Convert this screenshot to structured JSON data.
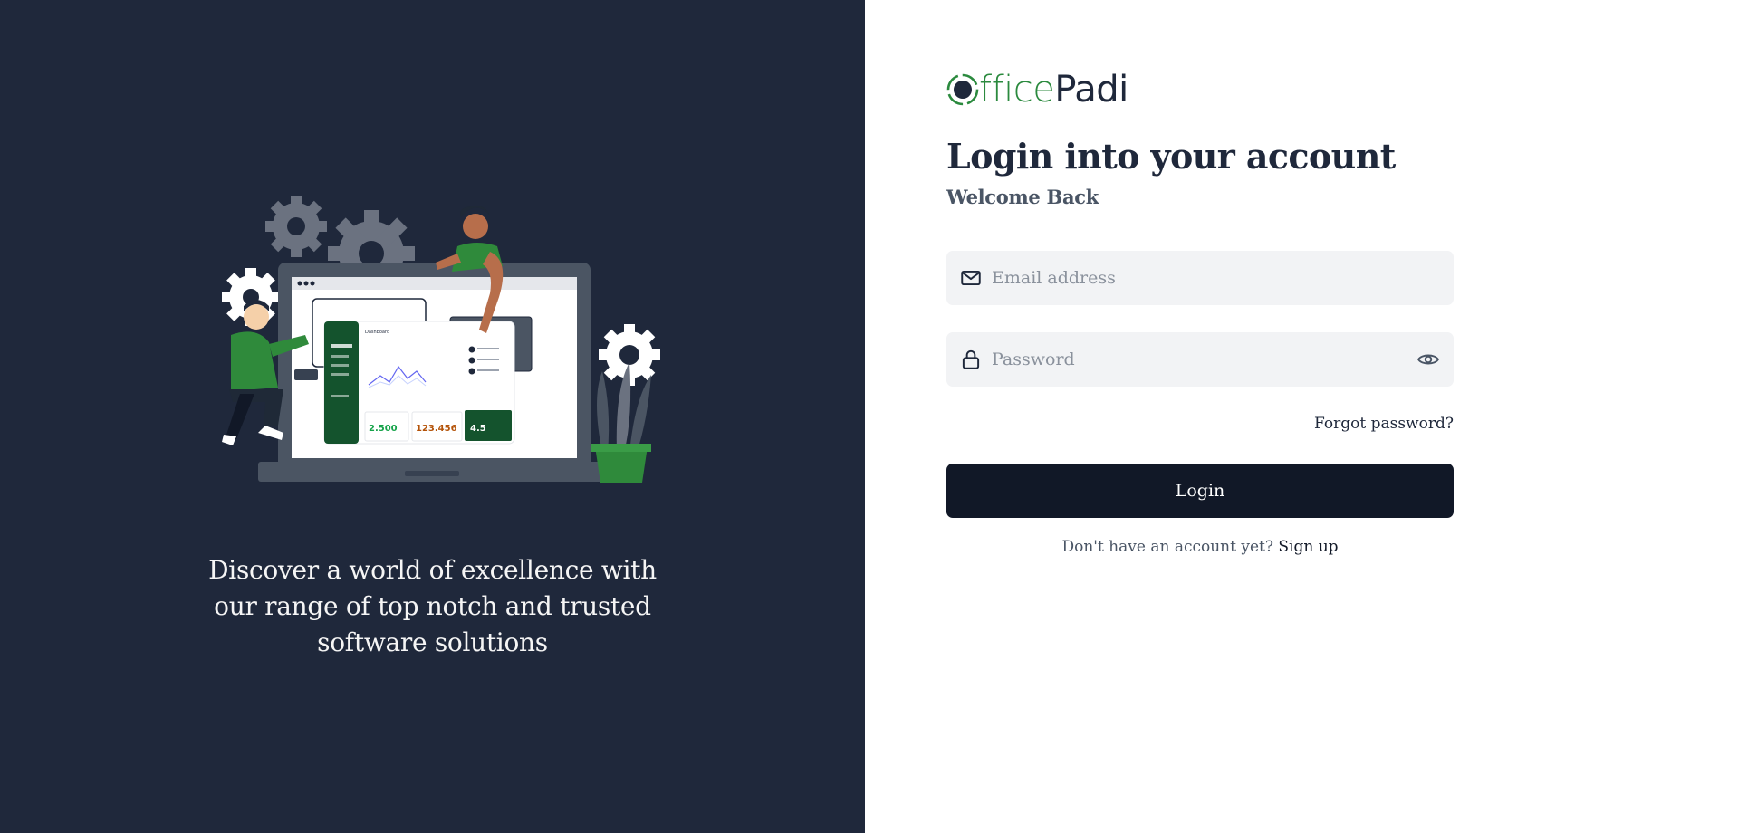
{
  "brand": {
    "logo_office": "ffice",
    "logo_padi": "Padi",
    "colors": {
      "green": "#2b8a3e",
      "navy": "#1f283b",
      "button": "#111827"
    }
  },
  "left": {
    "tagline": "Discover a world of excellence with our range of top notch and trusted software solutions",
    "illustration": {
      "dashboard_title": "Dashboard",
      "stat_1": "2.500",
      "stat_2": "123.456",
      "stat_3": "4.5"
    }
  },
  "login": {
    "title": "Login into your account",
    "subtitle": "Welcome Back",
    "email_placeholder": "Email address",
    "password_placeholder": "Password",
    "forgot_label": "Forgot password?",
    "login_label": "Login",
    "signup_prompt": "Don't have an account yet?",
    "signup_label": "Sign up"
  },
  "icons": [
    "mail-icon",
    "lock-icon",
    "eye-icon",
    "logo-mark-icon"
  ]
}
